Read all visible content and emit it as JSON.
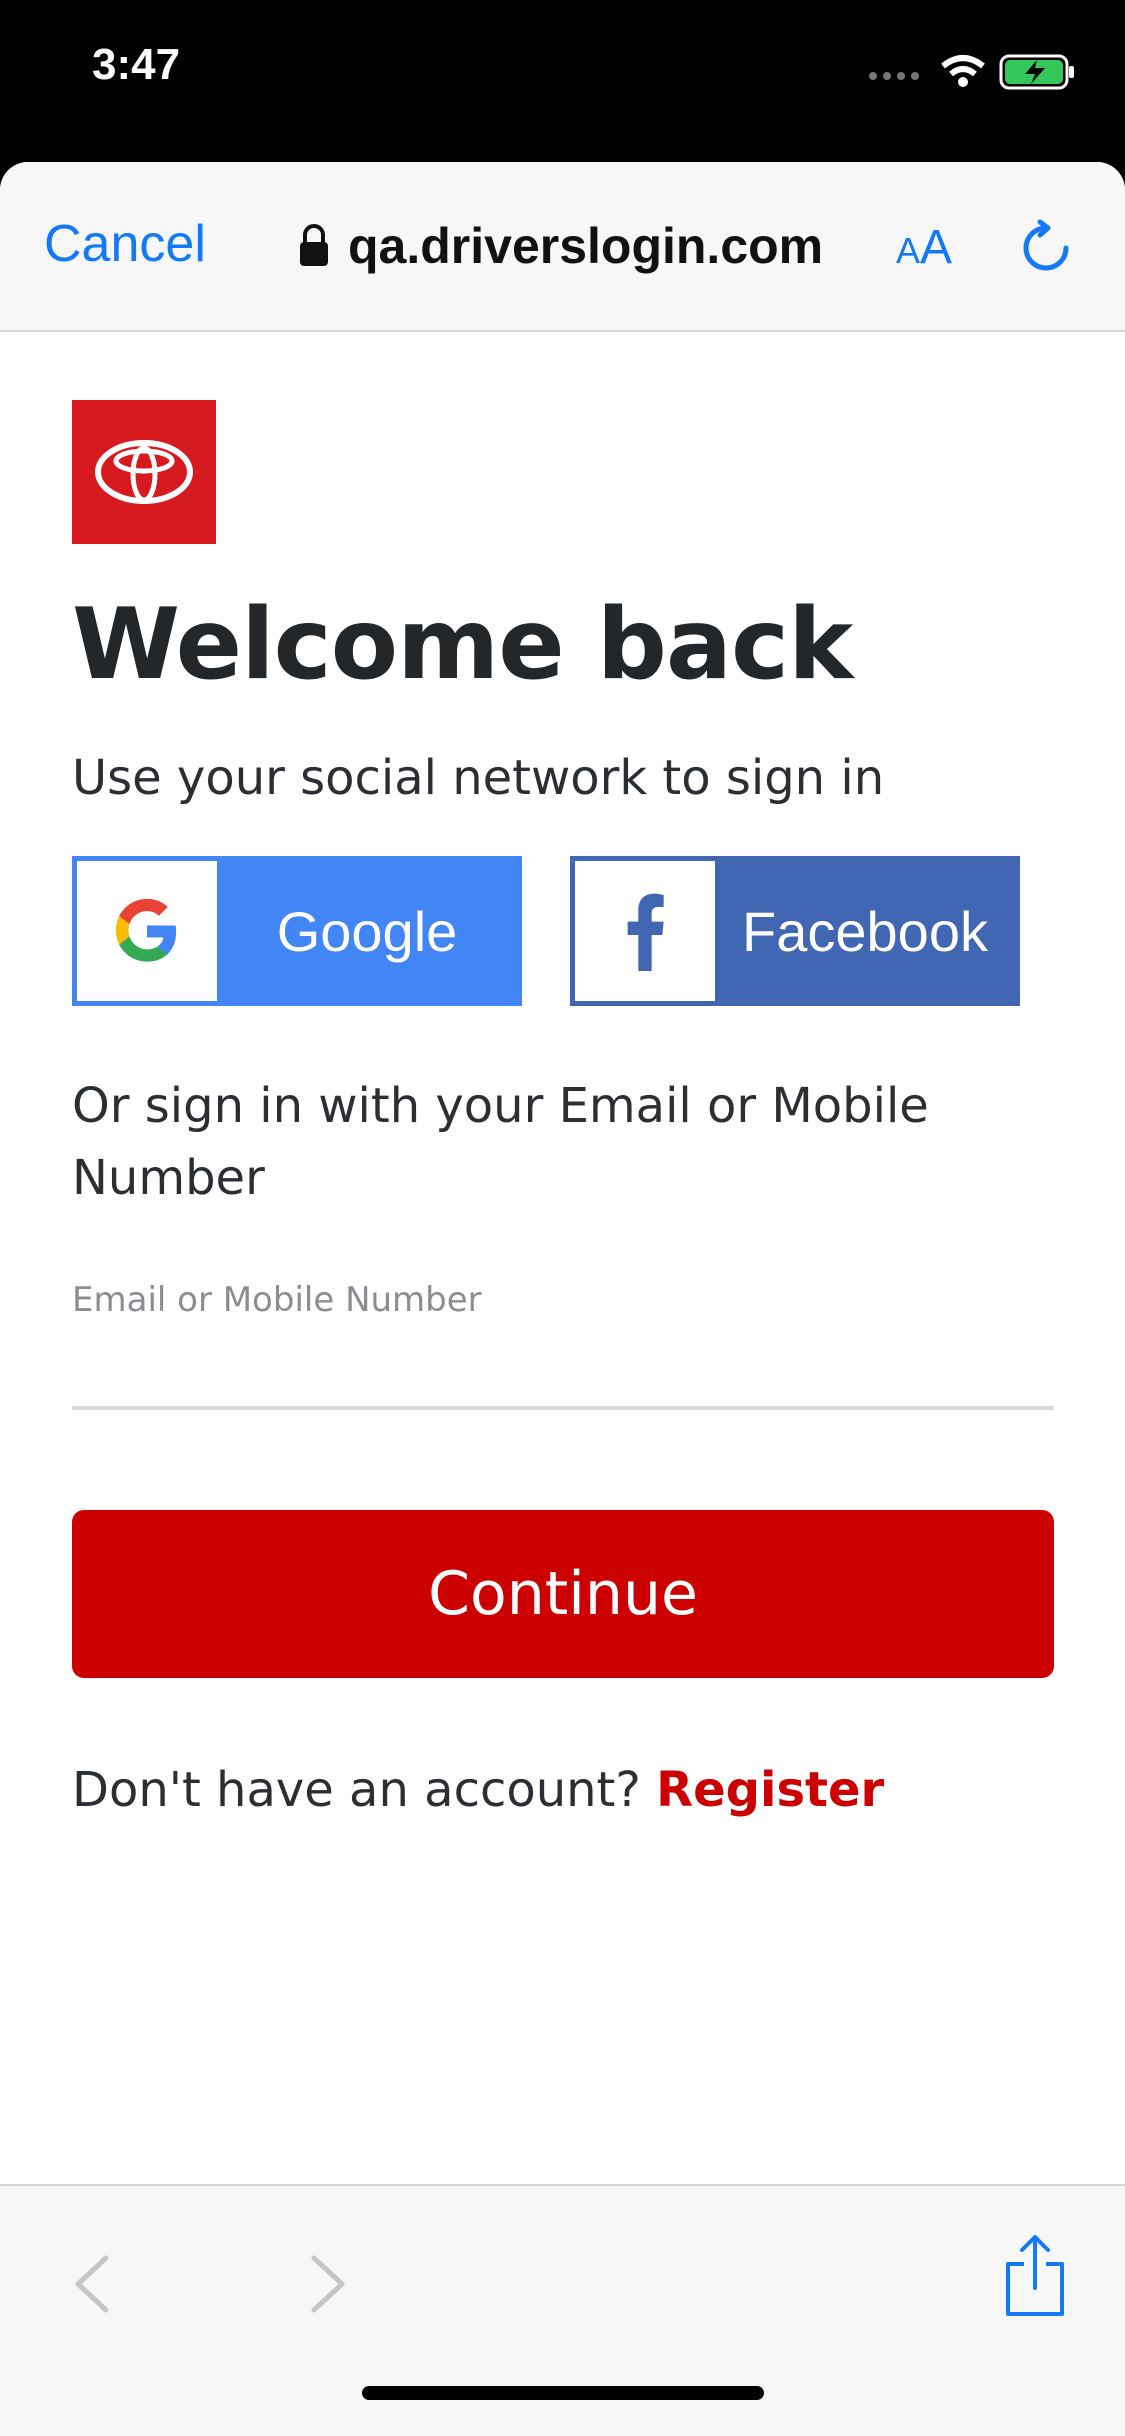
{
  "status_bar": {
    "time": "3:47"
  },
  "browser": {
    "cancel_label": "Cancel",
    "url": "qa.driverslogin.com",
    "text_size_small": "A",
    "text_size_big": "A"
  },
  "page": {
    "title": "Welcome back",
    "subtitle": "Use your social network to sign in",
    "google_label": "Google",
    "facebook_label": "Facebook",
    "or_text": "Or sign in with your Email or Mobile Number",
    "email_label": "Email or Mobile Number",
    "email_value": "",
    "continue_label": "Continue",
    "no_account_text": "Don't have an account?",
    "register_label": "Register"
  },
  "colors": {
    "brand_red": "#cc0000",
    "google_blue": "#4285f4",
    "facebook_blue": "#4267b2",
    "ios_blue": "#1479f6"
  }
}
